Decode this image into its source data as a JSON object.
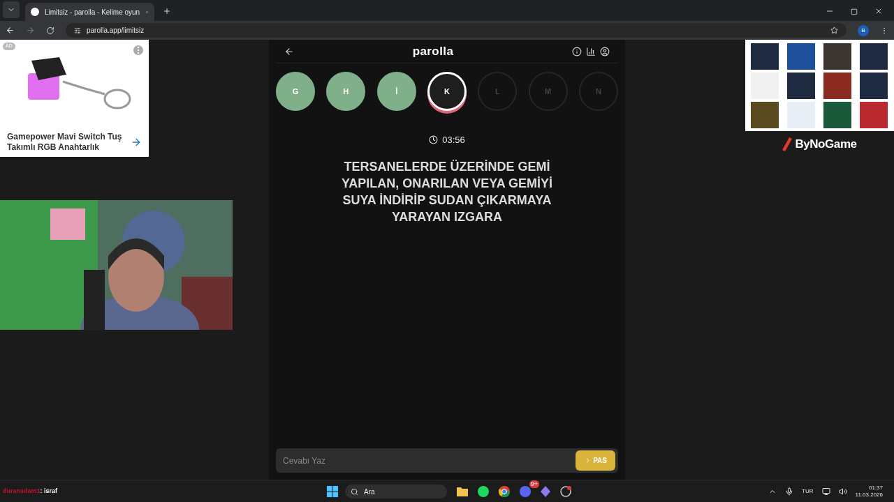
{
  "browser": {
    "tab_title": "Limitsiz - parolla - Kelime oyun",
    "url": "parolla.app/limitsiz",
    "profile": "B"
  },
  "ad": {
    "badge": "AD",
    "title": "Gamepower Mavi Switch Tuş Takımlı RGB Anahtarlık"
  },
  "game": {
    "title": "parolla",
    "letters": [
      {
        "letter": "G",
        "answered": true,
        "selected": false
      },
      {
        "letter": "H",
        "answered": true,
        "selected": false
      },
      {
        "letter": "İ",
        "answered": true,
        "selected": false
      },
      {
        "letter": "K",
        "answered": false,
        "selected": true
      },
      {
        "letter": "L",
        "answered": false,
        "selected": false
      },
      {
        "letter": "M",
        "answered": false,
        "selected": false
      },
      {
        "letter": "N",
        "answered": false,
        "selected": false
      }
    ],
    "timer": "03:56",
    "question": "TERSANELERDE ÜZERİNDE GEMİ YAPILAN, ONARILAN VEYA GEMİYİ SUYA İNDİRİP SUDAN ÇIKARMAYA YARAYAN IZGARA",
    "answer": {
      "placeholder": "Cevabı Yaz"
    },
    "pass_button": "PAS"
  },
  "side_ad": {
    "logo": "ByNoGame"
  },
  "chat": {
    "user": "duranadam1",
    "message": ": israf"
  },
  "taskbar": {
    "search": "Ara",
    "discord_badge": "9+",
    "language": "TUR",
    "time": "01:37",
    "date": "11.03.2026"
  }
}
